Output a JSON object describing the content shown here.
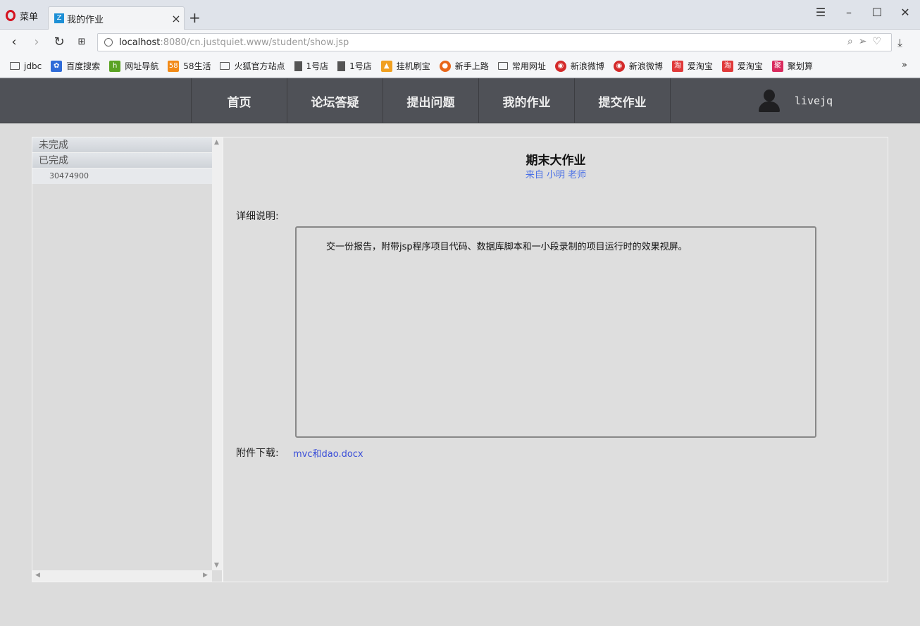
{
  "browser": {
    "menu_label": "菜单",
    "tab_title": "我的作业",
    "url_host": "localhost",
    "url_rest": ":8080/cn.justquiet.www/student/show.jsp",
    "bookmarks": [
      {
        "label": "jdbc",
        "icon": "folder-icon"
      },
      {
        "label": "百度搜索",
        "icon": "baidu-icon"
      },
      {
        "label": "网址导航",
        "icon": "hao123-icon"
      },
      {
        "label": "58生活",
        "icon": "58-icon"
      },
      {
        "label": "火狐官方站点",
        "icon": "folder-icon"
      },
      {
        "label": "1号店",
        "icon": "file-icon"
      },
      {
        "label": "1号店",
        "icon": "file-icon"
      },
      {
        "label": "挂机刷宝",
        "icon": "pma-icon"
      },
      {
        "label": "新手上路",
        "icon": "firefox-icon"
      },
      {
        "label": "常用网址",
        "icon": "folder-icon"
      },
      {
        "label": "新浪微博",
        "icon": "weibo-icon"
      },
      {
        "label": "新浪微博",
        "icon": "weibo-icon"
      },
      {
        "label": "爱淘宝",
        "icon": "taobao-icon"
      },
      {
        "label": "爱淘宝",
        "icon": "taobao-icon"
      },
      {
        "label": "聚划算",
        "icon": "juhuasuan-icon"
      }
    ]
  },
  "nav": {
    "items": [
      "首页",
      "论坛答疑",
      "提出问题",
      "我的作业",
      "提交作业"
    ],
    "username": "livejq"
  },
  "sidebar": {
    "group_incomplete": "未完成",
    "group_complete": "已完成",
    "complete_items": [
      "30474900"
    ]
  },
  "homework": {
    "title": "期末大作业",
    "from": "来自 小明 老师",
    "detail_label": "详细说明:",
    "detail_text": "交一份报告，附带jsp程序项目代码、数据库脚本和一小段录制的项目运行时的效果视屏。",
    "attachment_label": "附件下载:",
    "attachment_name": "mvc和dao.docx"
  },
  "colors": {
    "nav_bg": "#4f5157",
    "link": "#3b4fd8",
    "from_text": "#4a70e6",
    "page_bg": "#dcdcdc"
  }
}
